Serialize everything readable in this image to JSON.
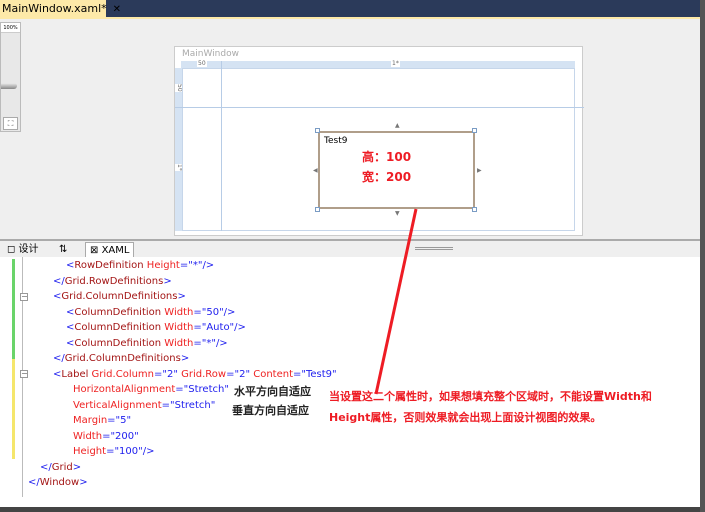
{
  "tab": {
    "title": "MainWindow.xaml*",
    "close": "✕"
  },
  "zoom": {
    "level": "100%",
    "fit_icon": "⛶"
  },
  "designer": {
    "window_title": "MainWindow",
    "col_ruler": [
      "50",
      "1*"
    ],
    "row_ruler": [
      "50",
      "1*"
    ],
    "label_content": "Test9",
    "annot_height": "高：100",
    "annot_width": "宽：200"
  },
  "bottom_tabs": {
    "design": "设计",
    "swap": "⇅",
    "xaml": "XAML"
  },
  "code_lines": [
    {
      "indent": 66,
      "segs": [
        [
          "b",
          "<"
        ],
        [
          "m",
          "RowDefinition "
        ],
        [
          "r",
          "Height"
        ],
        [
          "b",
          "=\"*\"/>"
        ]
      ]
    },
    {
      "indent": 53,
      "segs": [
        [
          "b",
          "</"
        ],
        [
          "m",
          "Grid.RowDefinitions"
        ],
        [
          "b",
          ">"
        ]
      ]
    },
    {
      "indent": 53,
      "segs": [
        [
          "b",
          "<"
        ],
        [
          "m",
          "Grid.ColumnDefinitions"
        ],
        [
          "b",
          ">"
        ]
      ]
    },
    {
      "indent": 66,
      "segs": [
        [
          "b",
          "<"
        ],
        [
          "m",
          "ColumnDefinition "
        ],
        [
          "r",
          "Width"
        ],
        [
          "b",
          "=\"50\"/>"
        ]
      ]
    },
    {
      "indent": 66,
      "segs": [
        [
          "b",
          "<"
        ],
        [
          "m",
          "ColumnDefinition "
        ],
        [
          "r",
          "Width"
        ],
        [
          "b",
          "=\"Auto\"/>"
        ]
      ]
    },
    {
      "indent": 66,
      "segs": [
        [
          "b",
          "<"
        ],
        [
          "m",
          "ColumnDefinition "
        ],
        [
          "r",
          "Width"
        ],
        [
          "b",
          "=\"*\"/>"
        ]
      ]
    },
    {
      "indent": 53,
      "segs": [
        [
          "b",
          "</"
        ],
        [
          "m",
          "Grid.ColumnDefinitions"
        ],
        [
          "b",
          ">"
        ]
      ]
    },
    {
      "indent": 53,
      "segs": [
        [
          "b",
          "<"
        ],
        [
          "m",
          "Label "
        ],
        [
          "r",
          "Grid.Column"
        ],
        [
          "b",
          "=\"2\" "
        ],
        [
          "r",
          "Grid.Row"
        ],
        [
          "b",
          "=\"2\" "
        ],
        [
          "r",
          "Content"
        ],
        [
          "b",
          "=\"Test9\""
        ]
      ]
    },
    {
      "indent": 73,
      "segs": [
        [
          "r",
          "HorizontalAlignment"
        ],
        [
          "b",
          "=\"Stretch\""
        ]
      ]
    },
    {
      "indent": 73,
      "segs": [
        [
          "r",
          "VerticalAlignment"
        ],
        [
          "b",
          "=\"Stretch\""
        ]
      ]
    },
    {
      "indent": 73,
      "segs": [
        [
          "r",
          "Margin"
        ],
        [
          "b",
          "=\"5\""
        ]
      ]
    },
    {
      "indent": 73,
      "segs": [
        [
          "r",
          "Width"
        ],
        [
          "b",
          "=\"200\""
        ]
      ]
    },
    {
      "indent": 73,
      "segs": [
        [
          "r",
          "Height"
        ],
        [
          "b",
          "=\"100\"/>"
        ]
      ]
    },
    {
      "indent": 40,
      "segs": [
        [
          "b",
          "</"
        ],
        [
          "m",
          "Grid"
        ],
        [
          "b",
          ">"
        ]
      ]
    },
    {
      "indent": 28,
      "segs": [
        [
          "b",
          "</"
        ],
        [
          "m",
          "Window"
        ],
        [
          "b",
          ">"
        ]
      ]
    }
  ],
  "notes": {
    "horizontal": "水平方向自适应",
    "vertical": "垂直方向自适应",
    "explanation_1": "当设置这二个属性时，如果想填充整个区域时，不能设置Width和",
    "explanation_2": "Height属性，否则效果就会出现上面设计视图的效果。"
  },
  "colors": {
    "annotation": "#ee1c24"
  }
}
